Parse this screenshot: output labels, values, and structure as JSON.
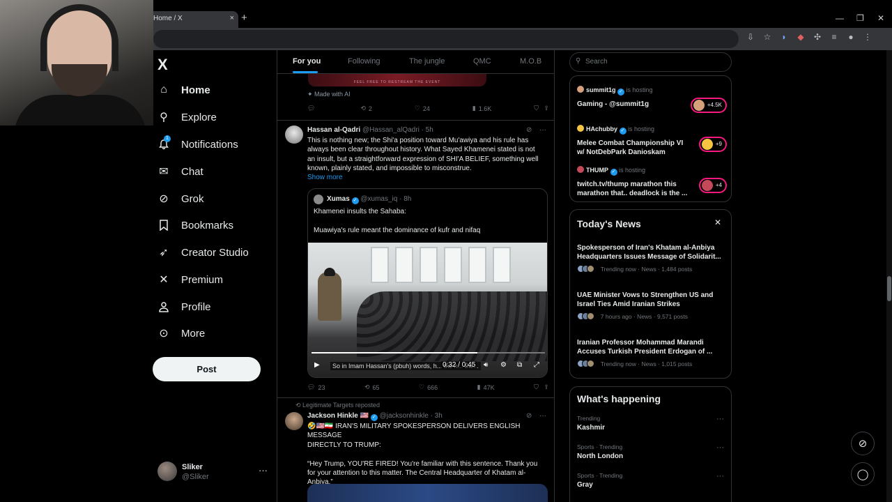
{
  "browser": {
    "tab_title": "Home / X",
    "tab_close": "×",
    "new_tab": "+",
    "window_controls": [
      "—",
      "❐",
      "✕"
    ]
  },
  "nav": {
    "logo": "X",
    "items": [
      {
        "label": "Home",
        "icon": "home-icon",
        "glyph": "⌂"
      },
      {
        "label": "Explore",
        "icon": "search-icon",
        "glyph": "⚲"
      },
      {
        "label": "Notifications",
        "icon": "bell-icon",
        "glyph": "♪"
      },
      {
        "label": "Chat",
        "icon": "mail-icon",
        "glyph": "✉"
      },
      {
        "label": "Grok",
        "icon": "grok-icon",
        "glyph": "⊘"
      },
      {
        "label": "Bookmarks",
        "icon": "bookmark-icon",
        "glyph": "⛉"
      },
      {
        "label": "Creator Studio",
        "icon": "rocket-icon",
        "glyph": "➶"
      },
      {
        "label": "Premium",
        "icon": "x-premium-icon",
        "glyph": "✕"
      },
      {
        "label": "Profile",
        "icon": "person-icon",
        "glyph": "☺"
      },
      {
        "label": "More",
        "icon": "more-circle-icon",
        "glyph": "⊙"
      }
    ],
    "notifications_badge": "1",
    "post_button": "Post",
    "account": {
      "name": "Sliker",
      "handle": "@Sliker",
      "more": "···"
    }
  },
  "feed_tabs": [
    "For you",
    "Following",
    "The jungle",
    "QMC",
    "M.O.B"
  ],
  "feed": {
    "prev_tweet": {
      "image_caption": "FEEL FREE TO RESTREAM THE EVENT",
      "made_with_ai": "Made with AI",
      "replies": "",
      "reposts": "2",
      "likes": "24",
      "views": "1.6K"
    },
    "tweet1": {
      "name": "Hassan al-Qadri",
      "handle": "@Hassan_alQadri",
      "time": "· 5h",
      "text_lines": [
        "This is nothing new; the Shi'a position toward Mu'awiya and his rule has",
        "always been clear throughout history. What Sayed Khamenei stated is not",
        "an insult, but a straightforward expression of SHI'A BELIEF, something well",
        "known, plainly stated, and impossible to misconstrue."
      ],
      "show_more": "Show more",
      "quote": {
        "name": "Xumas",
        "handle": "@xumas_iq",
        "time": "· 8h",
        "line1": "Khamenei insults the Sahaba:",
        "line2": "Muawiya's rule meant the dominance of kufr and nifaq",
        "subtitle": "So in Imam Hassan's (pbuh) words, h... the n... the...",
        "time_display": "0:32 / 0:45",
        "progress": 0.71
      },
      "replies": "23",
      "reposts": "65",
      "likes": "666",
      "views": "47K"
    },
    "tweet2": {
      "repost_by": "Legitimate Targets reposted",
      "name": "Jackson Hinkle 🇺🇸",
      "handle": "@jacksonhinkle",
      "time": "· 3h",
      "text_lines": [
        "🤣🇺🇸🇮🇷 IRAN'S MILITARY SPOKESPERSON DELIVERS ENGLISH MESSAGE",
        "DIRECTLY TO TRUMP:",
        "",
        "“Hey Trump, YOU'RE FIRED! You're familiar with this sentence. Thank you",
        "for your attention to this matter. The Central Headquarter of Khatam al-",
        "Anbiya.”"
      ]
    }
  },
  "right": {
    "search_placeholder": "Search",
    "live": [
      {
        "host": "summit1g",
        "status": "is hosting",
        "title": "Gaming - @summit1g",
        "count": "+4.5K",
        "color": "#d6a07a"
      },
      {
        "host": "HAchubby",
        "status": "is hosting",
        "title": "Melee Combat Championship VI w/ NotDebPark Danioskam",
        "count": "+9",
        "color": "#f5c542"
      },
      {
        "host": "THUMP",
        "status": "is hosting",
        "title": "twitch.tv/thump marathon this marathon that.. deadlock is the ...",
        "count": "+4",
        "color": "#c44a5a"
      }
    ],
    "news_title": "Today's News",
    "news_close": "✕",
    "news": [
      {
        "headline": "Spokesperson of Iran's Khatam al-Anbiya Headquarters Issues Message of Solidarit...",
        "meta": "Trending now · News · 1,484 posts"
      },
      {
        "headline": "UAE Minister Vows to Strengthen US and Israel Ties Amid Iranian Strikes",
        "meta": "7 hours ago · News · 9,571 posts"
      },
      {
        "headline": "Iranian Professor Mohammad Marandi Accuses Turkish President Erdogan of ...",
        "meta": "Trending now · News · 1,015 posts"
      }
    ],
    "happening_title": "What's happening",
    "trends": [
      {
        "context": "Trending",
        "topic": "Kashmir"
      },
      {
        "context": "Sports · Trending",
        "topic": "North London"
      },
      {
        "context": "Sports · Trending",
        "topic": "Gray"
      }
    ]
  },
  "colors": {
    "accent": "#1d9bf0",
    "live_ring": "#f91880",
    "bg": "#000000",
    "border": "#2f3336"
  }
}
